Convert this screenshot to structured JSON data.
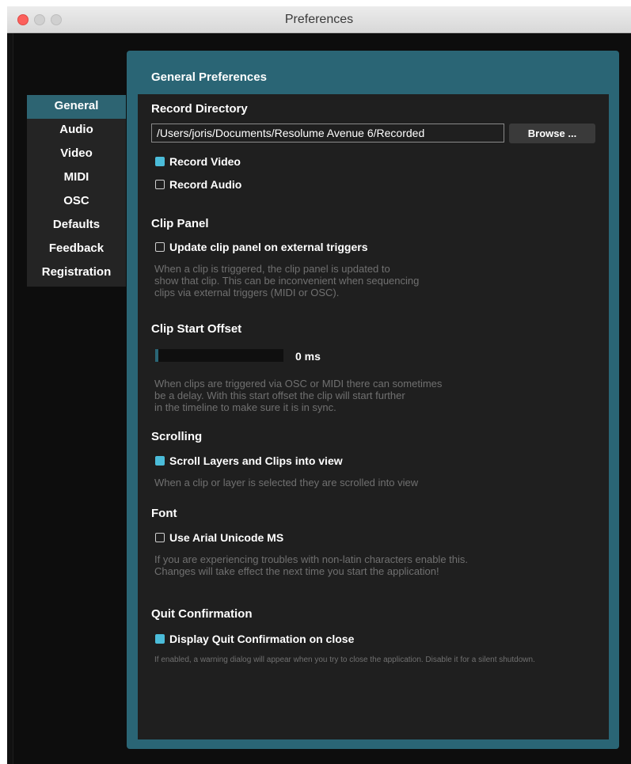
{
  "window": {
    "title": "Preferences"
  },
  "sidebar": {
    "items": [
      {
        "label": "General"
      },
      {
        "label": "Audio"
      },
      {
        "label": "Video"
      },
      {
        "label": "MIDI"
      },
      {
        "label": "OSC"
      },
      {
        "label": "Defaults"
      },
      {
        "label": "Feedback"
      },
      {
        "label": "Registration"
      }
    ]
  },
  "panel": {
    "title": "General Preferences"
  },
  "record": {
    "heading": "Record Directory",
    "path": "/Users/joris/Documents/Resolume Avenue 6/Recorded",
    "browse_label": "Browse ...",
    "video_label": "Record Video",
    "video_checked": true,
    "audio_label": "Record Audio",
    "audio_checked": false
  },
  "clip_panel": {
    "heading": "Clip Panel",
    "option_label": "Update clip panel on external triggers",
    "option_checked": false,
    "desc_lines": [
      "When a clip is triggered, the clip panel is updated to",
      "show that clip. This can be inconvenient when sequencing",
      "clips via external triggers (MIDI or OSC)."
    ]
  },
  "clip_start": {
    "heading": "Clip Start Offset",
    "value_text": "0 ms",
    "desc_lines": [
      "When clips are triggered via OSC or MIDI there can sometimes",
      "be a delay. With this start offset the clip will start further",
      "in the timeline to make sure it is in sync."
    ]
  },
  "scrolling": {
    "heading": "Scrolling",
    "option_label": "Scroll Layers and Clips into view",
    "option_checked": true,
    "desc": "When a clip or layer is selected they are scrolled into view"
  },
  "font": {
    "heading": "Font",
    "option_label": "Use Arial Unicode MS",
    "option_checked": false,
    "desc_lines": [
      "If you are experiencing troubles with non-latin characters enable this.",
      "Changes will take effect the next time you start the application!"
    ]
  },
  "quit": {
    "heading": "Quit Confirmation",
    "option_label": "Display Quit Confirmation on close",
    "option_checked": true,
    "desc": "If enabled, a warning dialog will appear when you try to close the application. Disable it for a silent shutdown."
  },
  "colors": {
    "accent": "#2a6575",
    "checkbox_on": "#4bbcd9",
    "close_button": "#fc605c"
  }
}
